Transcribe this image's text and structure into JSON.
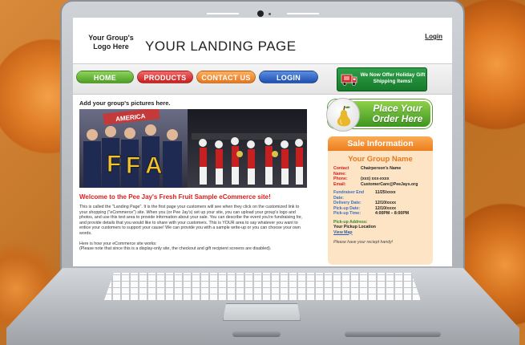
{
  "header": {
    "logo_text": "Your Group's Logo Here",
    "title": "YOUR LANDING PAGE",
    "login_link": "Login"
  },
  "nav": {
    "home": "HOME",
    "products": "PRODUCTS",
    "contact": "CONTACT US",
    "login": "LOGIN"
  },
  "promo": {
    "text": "We Now Offer Holiday Gift Shipping Items!"
  },
  "main": {
    "pics_heading": "Add your group's pictures here.",
    "welcome": "Welcome to the Pee Jay's Fresh Fruit Sample eCommerce site!",
    "paragraph1": "This is called the \"Landing Page\". It is the first page your customers will see when they click on the customized link to your shopping (\"eCommerce\") site. When you (or Pee Jay's) set up your site, you can upload your group's logo and photos, and use this text area to provide information about your sale. You can describe the event you're fundraising for, and provide details that you would like to share with your customers. This is YOUR area to say whatever you want to entice your customers to support your cause! We can provide you with a sample write-up or you can choose your own words.",
    "paragraph2": "Here is how your eCommerce site works:",
    "paragraph3": "(Please note that since this is a display-only site, the checkout and gift recipient screens are disabled)."
  },
  "order_button": {
    "text": "Place Your Order Here"
  },
  "sale": {
    "heading": "Sale Information",
    "group_name": "Your Group Name",
    "contact_name_label": "Contact Name:",
    "contact_name": "Chairperson's Name",
    "phone_label": "Phone:",
    "phone": "(xxx) xxx-xxxx",
    "email_label": "Email:",
    "email": "CustomerCare@PeeJays.org",
    "end_date_label": "Fundraiser End Date:",
    "end_date": "11/25/xxxx",
    "delivery_label": "Delivery Date:",
    "delivery": "12/10/xxxx",
    "pickup_date_label": "Pick-up Date:",
    "pickup_date": "12/10/xxxx",
    "pickup_time_label": "Pick-up Time:",
    "pickup_time": "4:00PM – 8:00PM",
    "address_label": "Pick-up Address:",
    "address": "Your Pickup Location",
    "map_link": "View Map",
    "receipt_note": "Please have your reciept handy!"
  },
  "photo": {
    "letters": [
      "F",
      "F",
      "A"
    ],
    "banner_text": "AMERICA"
  },
  "colors": {
    "nav_home": "#4e9e25",
    "nav_products": "#c81e1e",
    "nav_contact": "#e8761c",
    "nav_login": "#1f4fb0",
    "welcome_red": "#d92020",
    "sale_orange": "#ec7d1e",
    "sale_bg": "#fde4c4"
  }
}
